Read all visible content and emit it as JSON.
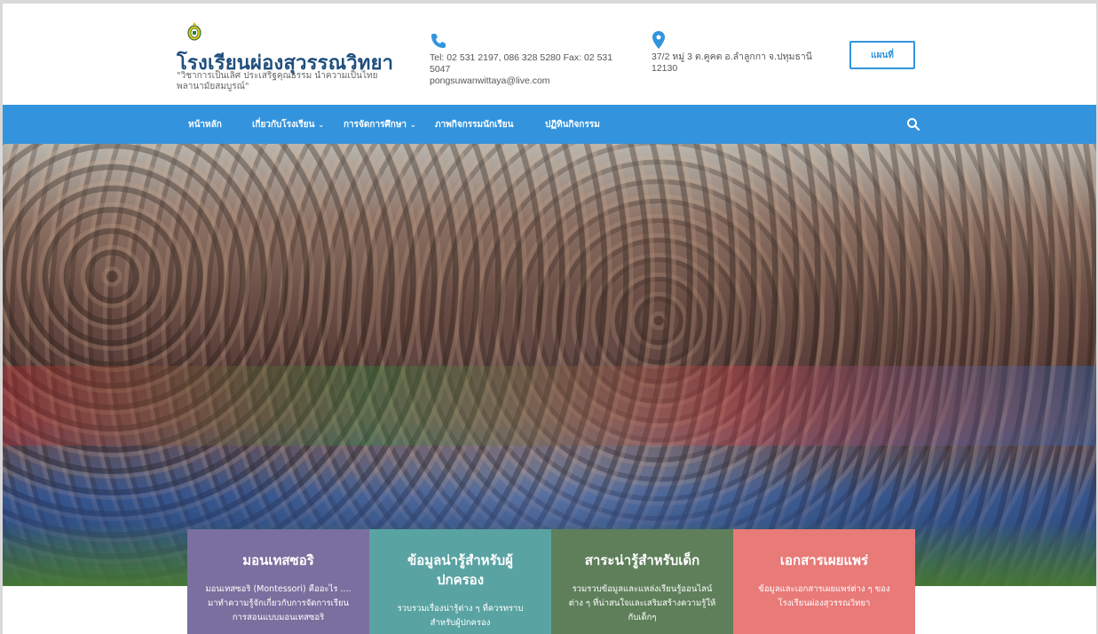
{
  "header": {
    "site_title": "โรงเรียนผ่องสุวรรณวิทยา",
    "tagline": "\"วิชาการเป็นเลิศ ประเสริฐคุณธรรม นำความเป็นไทย พลานามัยสมบูรณ์\"",
    "phone_text": "Tel: 02 531 2197, 086 328 5280 Fax: 02 531 5047",
    "email_text": "pongsuwanwittaya@live.com",
    "address_text": "37/2 หมู่ 3 ต.คูคต อ.ลำลูกกา จ.ปทุมธานี 12130",
    "map_button_label": "แผนที่"
  },
  "nav": {
    "items": [
      {
        "label": "หน้าหลัก",
        "has_dropdown": false
      },
      {
        "label": "เกี่ยวกับโรงเรียน",
        "has_dropdown": true
      },
      {
        "label": "การจัดการศึกษา",
        "has_dropdown": true
      },
      {
        "label": "ภาพกิจกรรมนักเรียน",
        "has_dropdown": false
      },
      {
        "label": "ปฏิทินกิจกรรม",
        "has_dropdown": false
      }
    ],
    "search_icon": "search-icon"
  },
  "cards": [
    {
      "title": "มอนเทสซอริ",
      "text": "มอนเทสซอริ (Montessori) คืออะไร .... มาทำความรู้จักเกี่ยวกับการจัดการเรียนการสอนแบบมอนเทสซอริ",
      "color": "#7a6f9e"
    },
    {
      "title": "ข้อมูลน่ารู้สำหรับผู้ปกครอง",
      "text": "รวบรวมเรื่องน่ารู้ต่าง ๆ ที่ควรทราบสำหรับผู้ปกครอง",
      "color": "#5aa3a3"
    },
    {
      "title": "สาระน่ารู้สำหรับเด็ก",
      "text": "รวมรวบข้อมูลและแหล่งเรียนรู้ออนไลน์ต่าง ๆ ที่น่าสนใจและเสริมสร้างความรู้ให้กับเด็กๆ",
      "color": "#5e7f5a"
    },
    {
      "title": "เอกสารเผยแพร่",
      "text": "ข้อมูลและเอกสารเผยแพร่ต่าง ๆ ของโรงเรียนผ่องสุวรรณวิทยา",
      "color": "#e87a78"
    }
  ],
  "colors": {
    "nav_bg": "#3394dd",
    "title_color": "#1f4e7d",
    "accent": "#3394dd"
  }
}
